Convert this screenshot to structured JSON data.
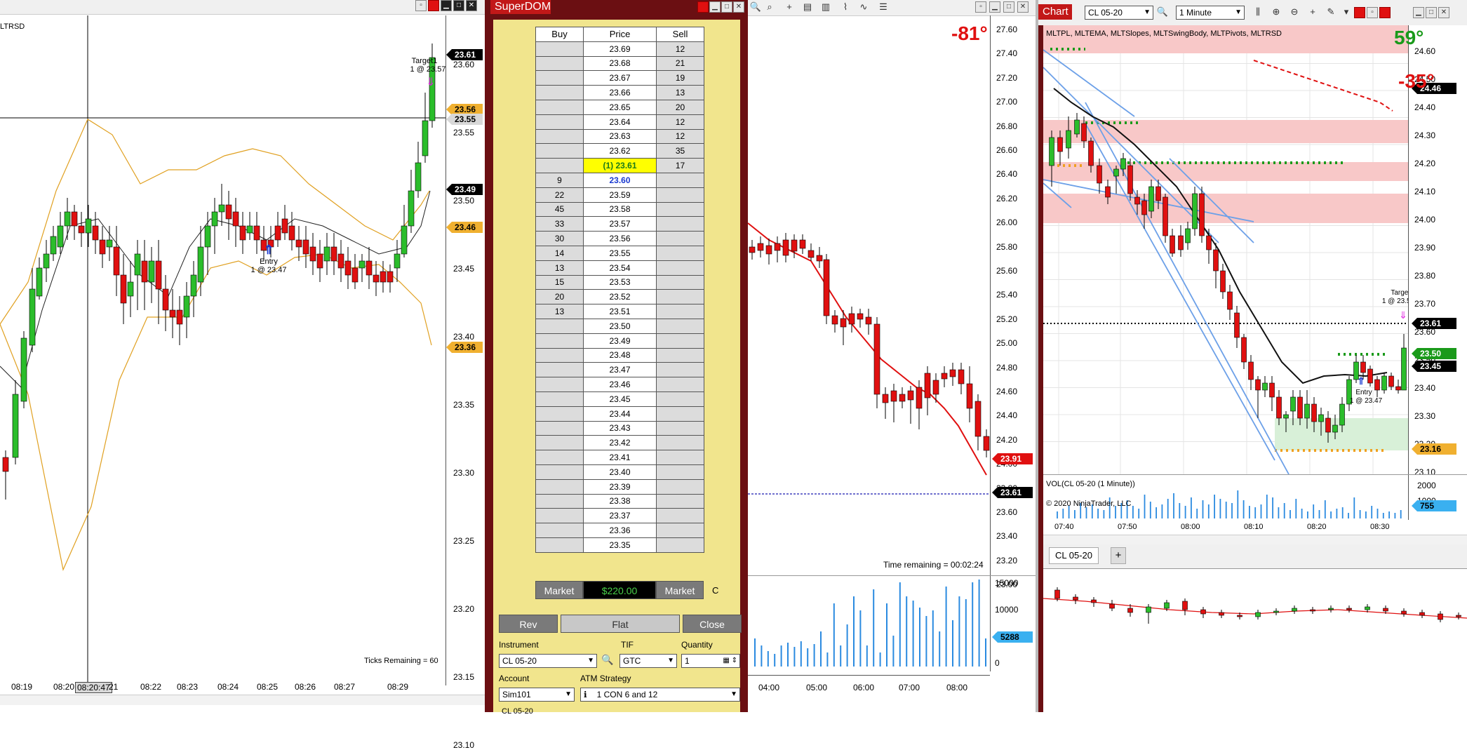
{
  "left_chart": {
    "indicator_label": "LTRSD",
    "price_axis": [
      "23.60",
      "23.55",
      "23.50",
      "23.45",
      "23.40",
      "23.35",
      "23.30",
      "23.25",
      "23.20",
      "23.15",
      "23.10"
    ],
    "tags": {
      "p1": "23.61",
      "p2": "23.56",
      "p3": "23.55",
      "p4": "23.49",
      "p5": "23.46",
      "p6": "23.36"
    },
    "time_axis": [
      "08:19",
      "08:20",
      "08:20:47",
      "21",
      "08:22",
      "08:23",
      "08:24",
      "08:25",
      "08:26",
      "08:27",
      "08:29"
    ],
    "target_label": "Target1",
    "target_sub": "1 @ 23.57",
    "entry_label": "Entry",
    "entry_sub": "1 @ 23.47",
    "ticks_remaining": "Ticks Remaining = 60"
  },
  "superdom": {
    "title": "SuperDOM",
    "headers": {
      "buy": "Buy",
      "price": "Price",
      "sell": "Sell"
    },
    "rows": [
      {
        "buy": "",
        "price": "23.69",
        "sell": "12"
      },
      {
        "buy": "",
        "price": "23.68",
        "sell": "21"
      },
      {
        "buy": "",
        "price": "23.67",
        "sell": "19"
      },
      {
        "buy": "",
        "price": "23.66",
        "sell": "13"
      },
      {
        "buy": "",
        "price": "23.65",
        "sell": "20"
      },
      {
        "buy": "",
        "price": "23.64",
        "sell": "12"
      },
      {
        "buy": "",
        "price": "23.63",
        "sell": "12"
      },
      {
        "buy": "",
        "price": "23.62",
        "sell": "35"
      },
      {
        "buy": "",
        "price": "(1) 23.61",
        "sell": "17"
      },
      {
        "buy": "9",
        "price": "23.60",
        "sell": ""
      },
      {
        "buy": "22",
        "price": "23.59",
        "sell": ""
      },
      {
        "buy": "45",
        "price": "23.58",
        "sell": ""
      },
      {
        "buy": "33",
        "price": "23.57",
        "sell": ""
      },
      {
        "buy": "30",
        "price": "23.56",
        "sell": ""
      },
      {
        "buy": "14",
        "price": "23.55",
        "sell": ""
      },
      {
        "buy": "13",
        "price": "23.54",
        "sell": ""
      },
      {
        "buy": "15",
        "price": "23.53",
        "sell": ""
      },
      {
        "buy": "20",
        "price": "23.52",
        "sell": ""
      },
      {
        "buy": "13",
        "price": "23.51",
        "sell": ""
      },
      {
        "buy": "",
        "price": "23.50",
        "sell": ""
      },
      {
        "buy": "",
        "price": "23.49",
        "sell": ""
      },
      {
        "buy": "",
        "price": "23.48",
        "sell": ""
      },
      {
        "buy": "",
        "price": "23.47",
        "sell": ""
      },
      {
        "buy": "",
        "price": "23.46",
        "sell": ""
      },
      {
        "buy": "",
        "price": "23.45",
        "sell": ""
      },
      {
        "buy": "",
        "price": "23.44",
        "sell": ""
      },
      {
        "buy": "",
        "price": "23.43",
        "sell": ""
      },
      {
        "buy": "",
        "price": "23.42",
        "sell": ""
      },
      {
        "buy": "",
        "price": "23.41",
        "sell": ""
      },
      {
        "buy": "",
        "price": "23.40",
        "sell": ""
      },
      {
        "buy": "",
        "price": "23.39",
        "sell": ""
      },
      {
        "buy": "",
        "price": "23.38",
        "sell": ""
      },
      {
        "buy": "",
        "price": "23.37",
        "sell": ""
      },
      {
        "buy": "",
        "price": "23.36",
        "sell": ""
      },
      {
        "buy": "",
        "price": "23.35",
        "sell": ""
      }
    ],
    "market_buy": "Market",
    "pnl": "$220.00",
    "market_sell": "Market",
    "c_label": "C",
    "rev": "Rev",
    "flat": "Flat",
    "close": "Close",
    "instrument_label": "Instrument",
    "instrument_value": "CL 05-20",
    "tif_label": "TIF",
    "tif_value": "GTC",
    "quantity_label": "Quantity",
    "quantity_value": "1",
    "account_label": "Account",
    "account_value": "Sim101",
    "atm_label": "ATM Strategy",
    "atm_value": "1 CON 6 and 12",
    "tab": "CL 05-20"
  },
  "middle_chart": {
    "angle": "-81°",
    "price_axis": [
      "27.60",
      "27.40",
      "27.20",
      "27.00",
      "26.80",
      "26.60",
      "26.40",
      "26.20",
      "26.00",
      "25.80",
      "25.60",
      "25.40",
      "25.20",
      "25.00",
      "24.80",
      "24.60",
      "24.40",
      "24.20",
      "24.00",
      "23.80",
      "23.60",
      "23.40",
      "23.20",
      "23.00"
    ],
    "tags": {
      "ema": "23.91",
      "last": "23.61"
    },
    "time_remaining": "Time remaining = 00:02:24",
    "vol_axis": [
      "15000",
      "10000",
      "5000",
      "0"
    ],
    "vol_tag": "5288",
    "time_axis": [
      "04:00",
      "05:00",
      "06:00",
      "07:00",
      "08:00"
    ]
  },
  "right_chart": {
    "title": "Chart",
    "instrument": "CL 05-20",
    "interval": "1 Minute",
    "indicators": "MLTPL, MLTEMA, MLTSlopes, MLTSwingBody, MLTPivots, MLTRSD",
    "angle_up": "59°",
    "angle_down": "-35°",
    "price_axis": [
      "24.60",
      "24.50",
      "24.40",
      "24.30",
      "24.20",
      "24.10",
      "24.00",
      "23.90",
      "23.80",
      "23.70",
      "23.60",
      "23.50",
      "23.40",
      "23.30",
      "23.20",
      "23.10"
    ],
    "tags": {
      "t1": "24.46",
      "t2": "23.61",
      "t3": "23.50",
      "t4": "23.45",
      "t5": "23.16"
    },
    "target_label": "Target1",
    "target_sub": "1 @ 23.57",
    "entry_label": "Entry",
    "entry_sub": "1 @ 23.47",
    "vol_label": "VOL(CL 05-20 (1 Minute))",
    "copyright": "© 2020 NinjaTrader, LLC",
    "vol_axis": [
      "2000",
      "1000"
    ],
    "vol_tag": "755",
    "time_axis": [
      "07:40",
      "07:50",
      "08:00",
      "08:10",
      "08:20",
      "08:30"
    ],
    "tab": "CL 05-20",
    "add_tab": "+"
  },
  "colors": {
    "up": "#2bbd2b",
    "down": "#e01010",
    "ema": "#e01010",
    "band": "#e0a020",
    "pivot_zone": "#f8c8c8",
    "green_zone": "#d8f0d8",
    "slope": "#6ca0e8",
    "vol": "#2a8ae0"
  }
}
